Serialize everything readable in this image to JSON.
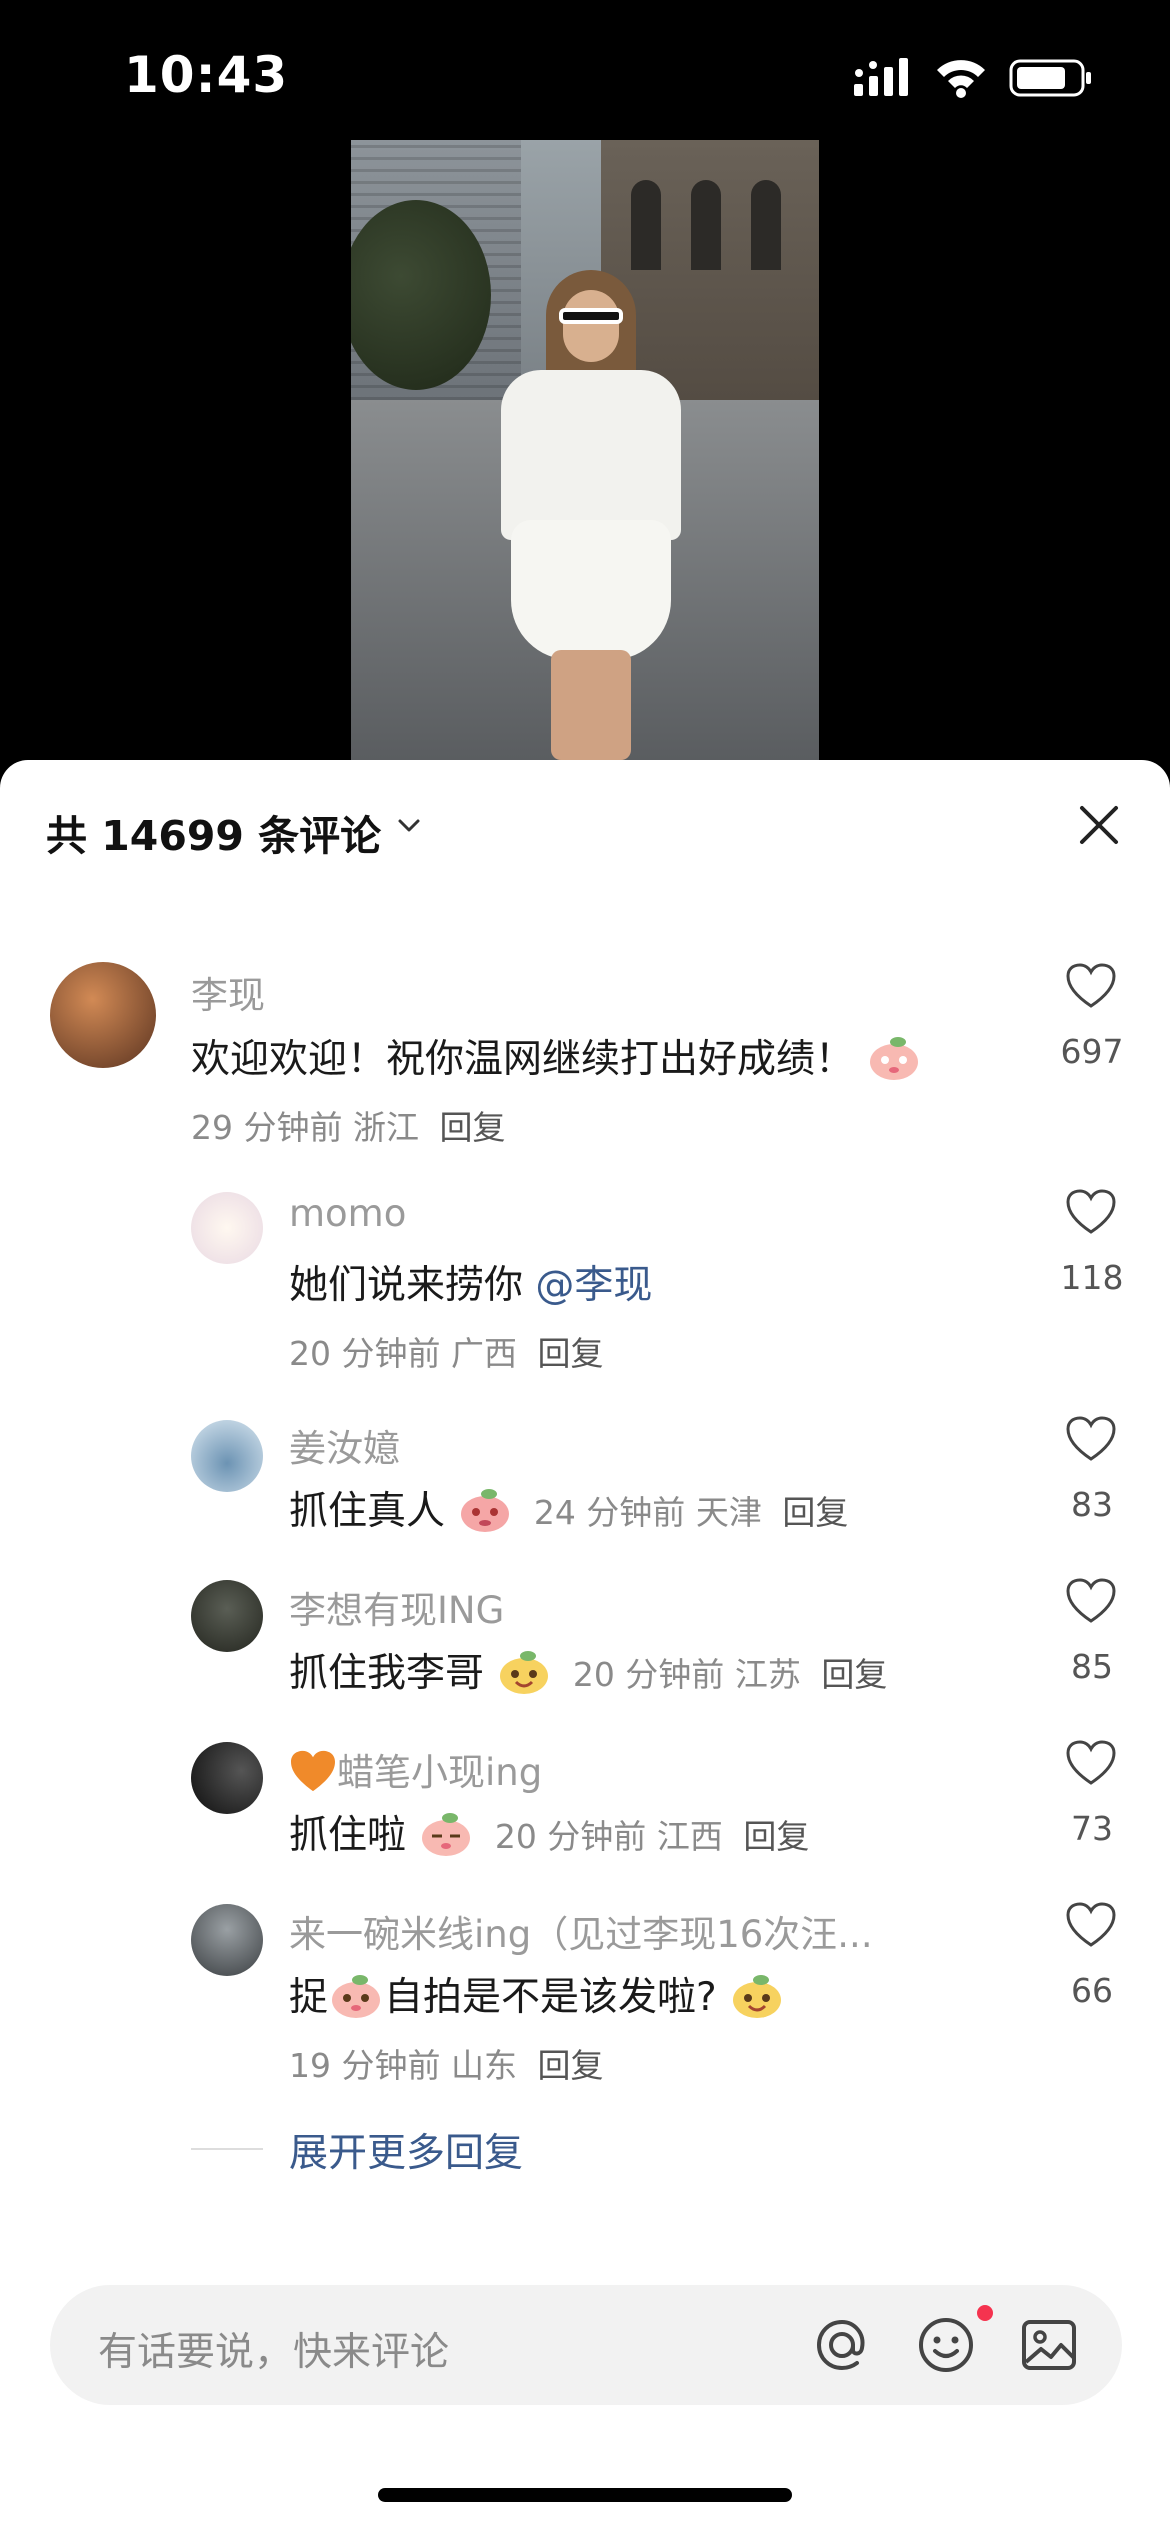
{
  "status_bar": {
    "time": "10:43"
  },
  "sheet": {
    "title": "共 14699 条评论",
    "input_placeholder": "有话要说，快来评论",
    "expand_more": "展开更多回复"
  },
  "comments": [
    {
      "name": "李现",
      "text": "欢迎欢迎！祝你温网继续打出好成绩！",
      "time": "29 分钟前",
      "location": "浙江",
      "reply": "回复",
      "likes": "697",
      "avatar_color": "#7a4a2a"
    },
    {
      "name": "momo",
      "text": "她们说来捞你 ",
      "mention": "@李现",
      "time": "20 分钟前",
      "location": "广西",
      "reply": "回复",
      "likes": "118",
      "avatar_color": "#f3ecf0"
    },
    {
      "name": "姜汝嬑",
      "text": "抓住真人",
      "time": "24 分钟前",
      "location": "天津",
      "reply": "回复",
      "likes": "83",
      "avatar_color": "#bcd3e6"
    },
    {
      "name": "李想有现ING",
      "text": "抓住我李哥",
      "time": "20 分钟前",
      "location": "江苏",
      "reply": "回复",
      "likes": "85",
      "avatar_color": "#3d4237"
    },
    {
      "name": "蜡笔小现ing",
      "text": "抓住啦",
      "time": "20 分钟前",
      "location": "江西",
      "reply": "回复",
      "likes": "73",
      "avatar_color": "#1b1b1b"
    },
    {
      "name": "来一碗米线ing（见过李现16次汪...",
      "text_a": "捉",
      "text_b": "自拍是不是该发啦?",
      "time": "19 分钟前",
      "location": "山东",
      "reply": "回复",
      "likes": "66",
      "avatar_color": "#6f7478"
    }
  ],
  "colors": {
    "accent_link": "#3a5a8c",
    "notification_dot": "#f5334f",
    "heart_badge": "#f08a2a"
  }
}
